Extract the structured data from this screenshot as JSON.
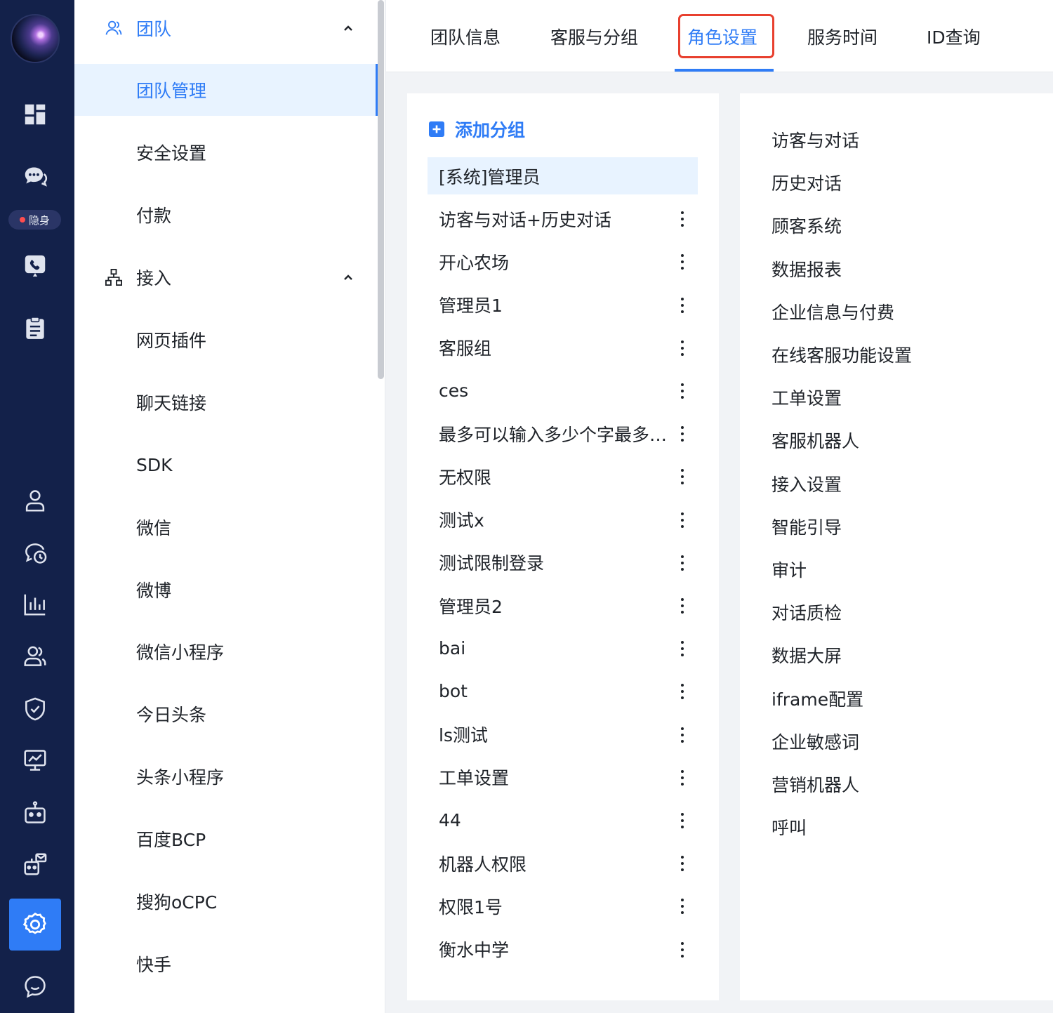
{
  "rail": {
    "status_label": "隐身",
    "icons": [
      "avatar",
      "dashboard-icon",
      "chat-icon",
      "phone-icon",
      "clipboard-icon",
      "user-icon",
      "history-chat-icon",
      "bar-chart-icon",
      "team-icon",
      "shield-icon",
      "monitor-chart-icon",
      "robot-icon",
      "marketing-robot-icon",
      "settings-icon",
      "feedback-icon"
    ]
  },
  "nav": {
    "team_group": {
      "label": "团队",
      "icon": "team-outline-icon"
    },
    "team_items": [
      "团队管理",
      "安全设置",
      "付款"
    ],
    "access_group": {
      "label": "接入",
      "icon": "network-icon"
    },
    "access_items": [
      "网页插件",
      "聊天链接",
      "SDK",
      "微信",
      "微博",
      "微信小程序",
      "今日头条",
      "头条小程序",
      "百度BCP",
      "搜狗oCPC",
      "快手"
    ],
    "active_item": "团队管理"
  },
  "tabs": [
    {
      "label": "团队信息"
    },
    {
      "label": "客服与分组"
    },
    {
      "label": "角色设置"
    },
    {
      "label": "服务时间"
    },
    {
      "label": "ID查询"
    }
  ],
  "active_tab": "角色设置",
  "roles_panel": {
    "add_label": "添加分组",
    "roles": [
      "[系统]管理员",
      "访客与对话+历史对话",
      "开心农场",
      "管理员1",
      "客服组",
      "ces",
      "最多可以输入多少个字最多可以输入多少个字",
      "无权限",
      "测试x",
      "测试限制登录",
      "管理员2",
      "bai",
      "bot",
      "ls测试",
      "工单设置",
      "44",
      "机器人权限",
      "权限1号",
      "衡水中学"
    ],
    "selected_role": "[系统]管理员"
  },
  "permissions": [
    "访客与对话",
    "历史对话",
    "顾客系统",
    "数据报表",
    "企业信息与付费",
    "在线客服功能设置",
    "工单设置",
    "客服机器人",
    "接入设置",
    "智能引导",
    "审计",
    "对话质检",
    "数据大屏",
    "iframe配置",
    "企业敏感词",
    "营销机器人",
    "呼叫"
  ],
  "colors": {
    "accent": "#2f7cf6",
    "rail_bg": "#13214a",
    "highlight_border": "#e8402f",
    "selected_bg": "#e8f3ff"
  }
}
